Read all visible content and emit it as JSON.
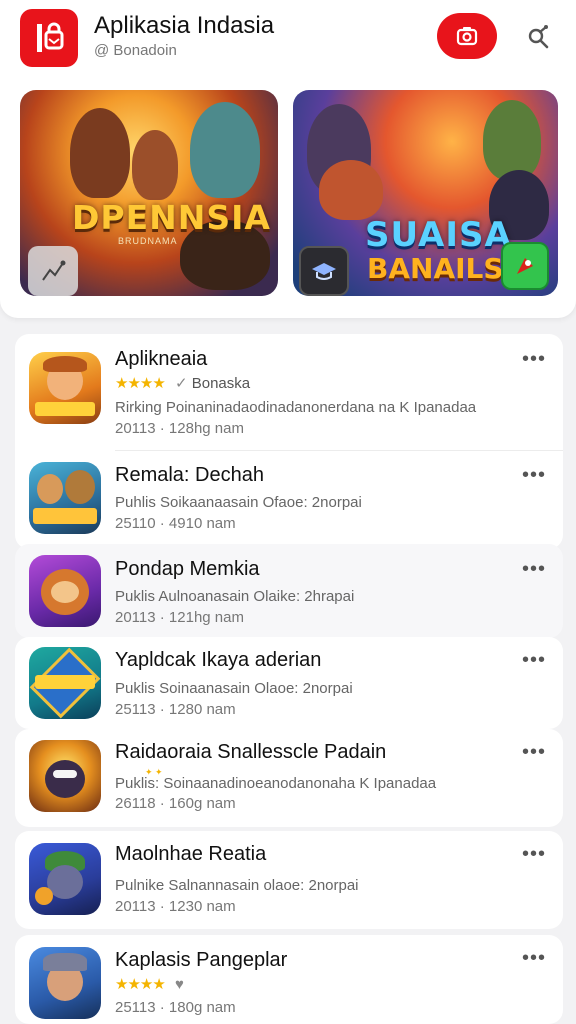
{
  "header": {
    "title": "Aplikasia Indasia",
    "subtitle": "@ Bonadoin",
    "logo_icon": "store-bag-icon",
    "camera_icon": "camera-icon",
    "share_icon": "search-share-icon",
    "brand_color": "#e8141b"
  },
  "banners": [
    {
      "title": "DPENNSIA",
      "subtitle": "BRUDNAMA"
    },
    {
      "title": "SUAISA",
      "subtitle": "BANAILS"
    }
  ],
  "apps": [
    {
      "name": "Aplikneaia",
      "stars": "★★★★",
      "rating_label": "Bonaska",
      "meta": "Rirking Poinaninadaodinadanonerdana na K Ipanadaa",
      "date": "20113 · 128hg nam"
    },
    {
      "name": "Remala: Dechah",
      "meta": "Puhlis Soikaanaasain Ofaoe: 2norpai",
      "date": "25110 · 4910 nam"
    },
    {
      "name": "Pondap Memkia",
      "meta": "Puklis Aulnoanasain Olaike: 2hrapai",
      "date": "20113 · 121hg nam"
    },
    {
      "name": "Yapldcak Ikaya aderian",
      "meta": "Puklis Soinaanasain Olaoe: 2norpai",
      "date": "25113 · 1280 nam"
    },
    {
      "name": "Raidaoraia Snallesscle Padain",
      "meta": "Puklis: Soinaanadinoeanodanonaha K Ipanadaa",
      "date": "26118 · 160g nam"
    },
    {
      "name": "Maolnhae Reatia",
      "meta": "Pulnike Salnannasain olaoe: 2norpai",
      "date": "20113 · 1230 nam"
    },
    {
      "name": "Kaplasis Pangeplar",
      "stars": "★★★★",
      "date": "25113 · 180g nam"
    }
  ],
  "more_label": "•••"
}
